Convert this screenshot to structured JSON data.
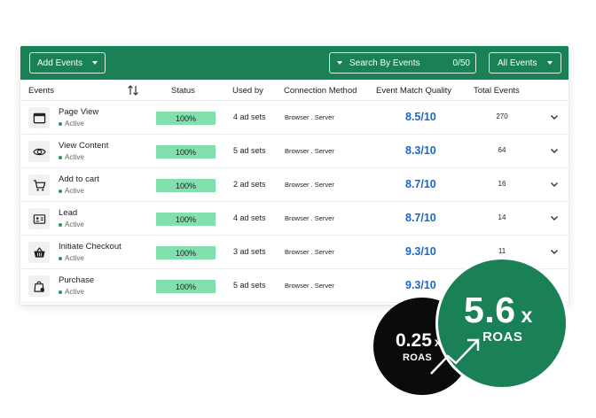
{
  "toolbar": {
    "add_label": "Add Events",
    "search_placeholder": "Search By Events",
    "search_count": "0/50",
    "filter_label": "All Events"
  },
  "table": {
    "headers": {
      "events": "Events",
      "status": "Status",
      "used_by": "Used by",
      "connection": "Connection Method",
      "emq": "Event Match Quality",
      "total": "Total Events"
    },
    "rows": [
      {
        "icon": "browser-window-icon",
        "name": "Page View",
        "status": "Active",
        "progress": "100%",
        "used_by": "4 ad sets",
        "connection": "Browser . Server",
        "emq": "8.5/10",
        "total": "270"
      },
      {
        "icon": "eye-icon",
        "name": "View Content",
        "status": "Active",
        "progress": "100%",
        "used_by": "5 ad sets",
        "connection": "Browser . Server",
        "emq": "8.3/10",
        "total": "64"
      },
      {
        "icon": "shopping-cart-icon",
        "name": "Add to cart",
        "status": "Active",
        "progress": "100%",
        "used_by": "2 ad sets",
        "connection": "Browser . Server",
        "emq": "8.7/10",
        "total": "16"
      },
      {
        "icon": "contact-card-icon",
        "name": "Lead",
        "status": "Active",
        "progress": "100%",
        "used_by": "4 ad sets",
        "connection": "Browser . Server",
        "emq": "8.7/10",
        "total": "14"
      },
      {
        "icon": "basket-icon",
        "name": "Initiate Checkout",
        "status": "Active",
        "progress": "100%",
        "used_by": "3 ad sets",
        "connection": "Browser . Server",
        "emq": "9.3/10",
        "total": "11"
      },
      {
        "icon": "shopping-bag-icon",
        "name": "Purchase",
        "status": "Active",
        "progress": "100%",
        "used_by": "5 ad sets",
        "connection": "Browser . Server",
        "emq": "9.3/10",
        "total": ""
      }
    ]
  },
  "roas_before": {
    "value": "0.25",
    "suffix": "x",
    "label": "ROAS"
  },
  "roas_after": {
    "value": "5.6",
    "suffix": "x",
    "label": "ROAS"
  },
  "colors": {
    "brand_green": "#1a8056",
    "progress_fill": "#82dfae",
    "emq_blue": "#1e66c4",
    "active_dot": "#1a9f4a"
  }
}
